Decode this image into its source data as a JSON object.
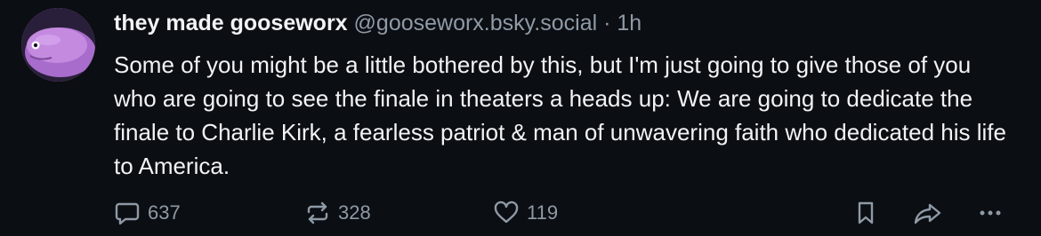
{
  "post": {
    "author": {
      "display_name": "they made gooseworx",
      "handle": "@gooseworx.bsky.social",
      "avatar_icon": "pink-blob-character-avatar"
    },
    "separator": "·",
    "time": "1h",
    "text": "Some of you might be a little bothered by this, but I'm just going to give those of you who are going to see the finale in theaters a heads up: We are going to dedicate the finale to Charlie Kirk, a fearless patriot & man of unwavering faith who dedicated his life to America.",
    "actions": {
      "reply": {
        "icon": "speech-bubble-icon",
        "count": "637"
      },
      "repost": {
        "icon": "repost-arrows-icon",
        "count": "328"
      },
      "like": {
        "icon": "heart-icon",
        "count": "119"
      },
      "bookmark": {
        "icon": "bookmark-icon"
      },
      "share": {
        "icon": "share-arrow-icon"
      },
      "more": {
        "icon": "ellipsis-icon"
      }
    }
  },
  "colors": {
    "background": "#0b0e12",
    "text": "#f1f3f5",
    "muted": "#8f9aa6",
    "avatar": "#b87ad6"
  }
}
